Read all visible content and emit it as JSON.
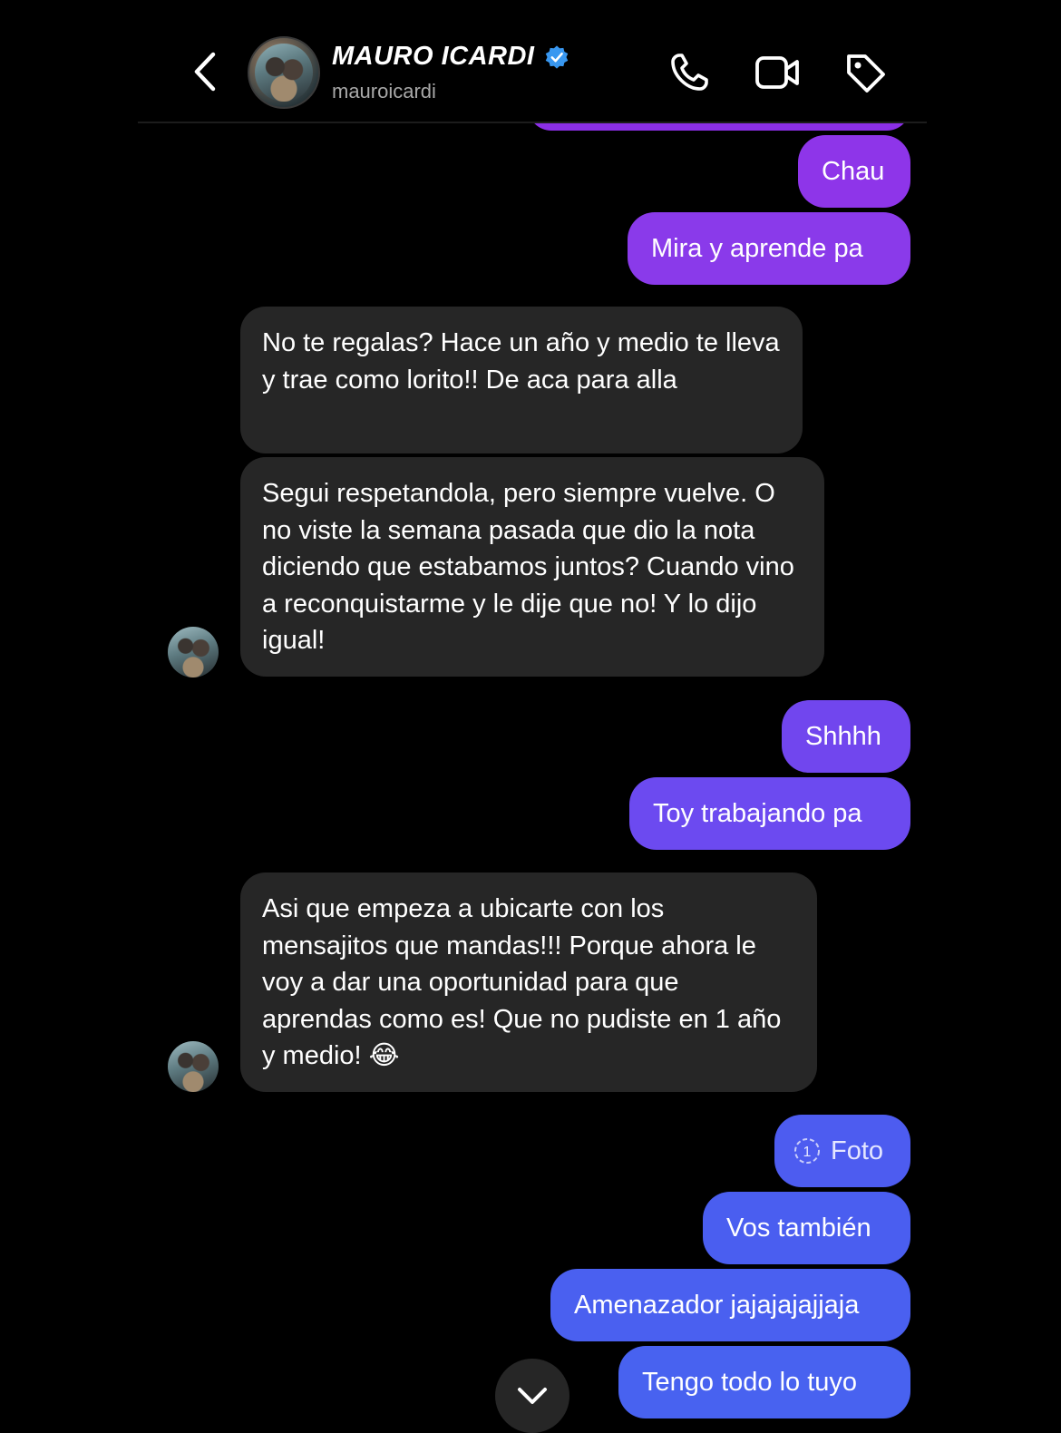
{
  "header": {
    "name": "MAURO ICARDI",
    "handle": "mauroicardi",
    "icons": {
      "back": "chevron-left-icon",
      "call": "phone-icon",
      "video": "video-camera-icon",
      "tag": "tag-icon",
      "verified": "verified-badge-icon"
    }
  },
  "colors": {
    "background": "#000000",
    "received_bubble": "#262626",
    "sent_top": "#8b3de8",
    "sent_mid": "#6c4cf0",
    "sent_bottom": "#4a5ef0",
    "verified": "#3897f0"
  },
  "messages": [
    {
      "type": "sent",
      "text": "Chau"
    },
    {
      "type": "sent",
      "text": "Mira y aprende pa"
    },
    {
      "type": "received",
      "text": "No te regalas? Hace un año y medio te lleva y trae como lorito!! De aca para alla"
    },
    {
      "type": "received",
      "text": "Segui respetandola, pero siempre vuelve. O no viste la semana pasada que dio la nota diciendo que estabamos juntos? Cuando vino a reconquistarme y le dije que no! Y lo dijo igual!"
    },
    {
      "type": "sent",
      "text": "Shhhh"
    },
    {
      "type": "sent",
      "text": "Toy trabajando pa"
    },
    {
      "type": "received",
      "text": "Asi que empeza a ubicarte con los mensajitos que mandas!!! Porque ahora le voy a dar una oportunidad para que aprendas como es! Que no pudiste en 1 año y medio! 😂"
    },
    {
      "type": "sent",
      "text": "Foto",
      "icon": "view-once-icon"
    },
    {
      "type": "sent",
      "text": "Vos también"
    },
    {
      "type": "sent",
      "text": "Amenazador jajajajajjaja"
    },
    {
      "type": "sent",
      "text": "Tengo todo lo tuyo"
    }
  ],
  "scroll_button_icon": "chevron-down-icon"
}
